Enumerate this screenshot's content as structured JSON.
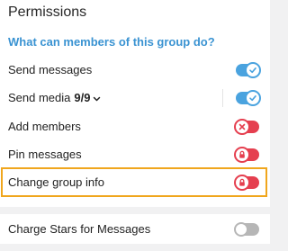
{
  "header": {
    "title": "Permissions"
  },
  "section": {
    "header": "What can members of this group do?"
  },
  "permissions": [
    {
      "label": "Send messages",
      "state": "on",
      "icon": "check-icon"
    },
    {
      "label": "Send media",
      "count": "9/9",
      "state": "on",
      "icon": "check-icon",
      "expandable": true
    },
    {
      "label": "Add members",
      "state": "off-red",
      "icon": "close-icon"
    },
    {
      "label": "Pin messages",
      "state": "locked",
      "icon": "lock-icon"
    },
    {
      "label": "Change group info",
      "state": "locked",
      "icon": "lock-icon",
      "highlighted": true
    }
  ],
  "extra": {
    "label": "Charge Stars for Messages",
    "state": "off"
  },
  "colors": {
    "accent": "#4aa3df",
    "danger": "#e53f4f",
    "highlight": "#f0a61d",
    "header": "#3a93d2"
  }
}
